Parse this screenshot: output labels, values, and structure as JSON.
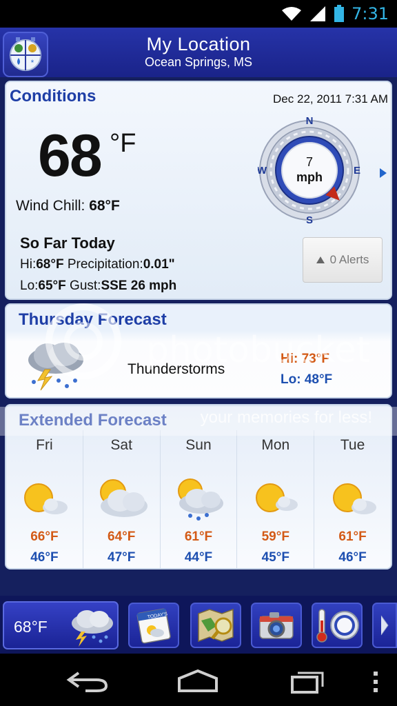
{
  "status_bar": {
    "time": "7:31"
  },
  "header": {
    "title": "My Location",
    "subtitle": "Ocean Springs, MS"
  },
  "conditions": {
    "title": "Conditions",
    "date": "Dec 22, 2011 7:31 AM",
    "temperature": "68",
    "unit": "°F",
    "wind_chill_label": "Wind Chill:",
    "wind_chill_value": "68°F",
    "wind": {
      "speed": "7",
      "unit": "mph",
      "n": "N",
      "e": "E",
      "s": "S",
      "w": "W",
      "direction_deg": 135
    },
    "so_far": {
      "title": "So Far Today",
      "hi_label": "Hi:",
      "hi_value": "68°F",
      "precip_label": "Precipitation:",
      "precip_value": "0.01\"",
      "lo_label": "Lo:",
      "lo_value": "65°F",
      "gust_label": "Gust:",
      "gust_value": "SSE 26 mph"
    },
    "alerts_label": "0 Alerts"
  },
  "thursday": {
    "title": "Thursday Forecast",
    "condition": "Thunderstorms",
    "icon": "thunderstorm-cloud-icon",
    "hi": "Hi: 73°F",
    "lo": "Lo: 48°F"
  },
  "extended": {
    "title": "Extended Forecast",
    "days": [
      {
        "day": "Fri",
        "icon": "sun-cloud-icon",
        "hi": "66°F",
        "lo": "46°F"
      },
      {
        "day": "Sat",
        "icon": "cloudy-sun-icon",
        "hi": "64°F",
        "lo": "47°F"
      },
      {
        "day": "Sun",
        "icon": "rain-cloud-sun-icon",
        "hi": "61°F",
        "lo": "44°F"
      },
      {
        "day": "Mon",
        "icon": "sun-cloud-icon",
        "hi": "59°F",
        "lo": "45°F"
      },
      {
        "day": "Tue",
        "icon": "sun-cloud-icon",
        "hi": "61°F",
        "lo": "46°F"
      }
    ]
  },
  "watermark": {
    "brand": "photobucket",
    "tagline": "your memories for less!"
  },
  "toolbar": {
    "current_temp": "68°F",
    "today_label": "TODAY'S",
    "buttons": [
      "calendar-icon",
      "map-icon",
      "camera-icon",
      "thermometer-icon",
      "compass-icon",
      "chevron-right-icon"
    ]
  },
  "colors": {
    "hi": "#d35a16",
    "lo": "#1d4fb0",
    "title": "#1e3ea6",
    "header": "#2633a8"
  }
}
